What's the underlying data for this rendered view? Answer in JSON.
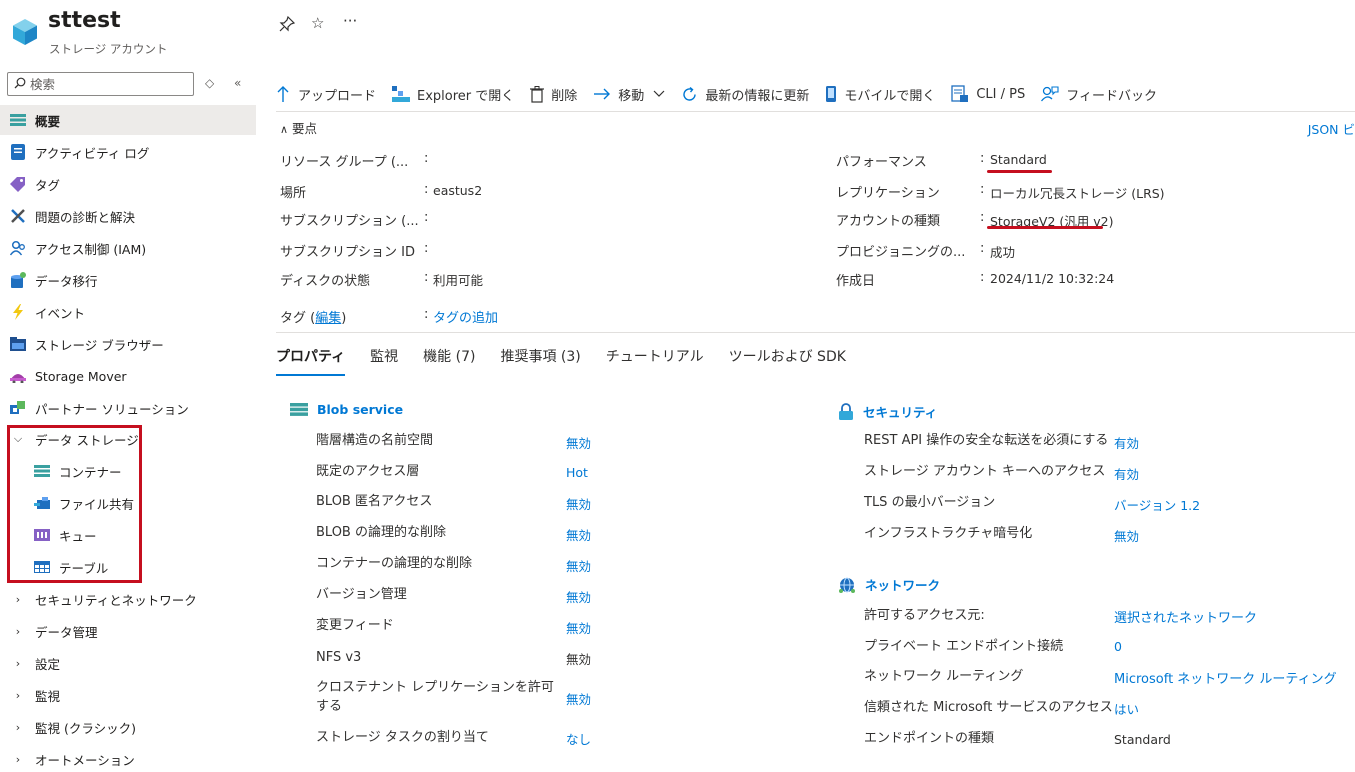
{
  "app": {
    "title": "sttest",
    "subtitle": "ストレージ アカウント"
  },
  "search": {
    "placeholder": "検索"
  },
  "sidebar": {
    "items": [
      {
        "label": "概要",
        "icon": "overview-icon"
      },
      {
        "label": "アクティビティ ログ",
        "icon": "activity-log-icon"
      },
      {
        "label": "タグ",
        "icon": "tag-icon"
      },
      {
        "label": "問題の診断と解決",
        "icon": "wrench-icon"
      },
      {
        "label": "アクセス制御 (IAM)",
        "icon": "iam-icon"
      },
      {
        "label": "データ移行",
        "icon": "data-migration-icon"
      },
      {
        "label": "イベント",
        "icon": "lightning-icon"
      },
      {
        "label": "ストレージ ブラウザー",
        "icon": "storage-browser-icon"
      },
      {
        "label": "Storage Mover",
        "icon": "storage-mover-icon"
      },
      {
        "label": "パートナー ソリューション",
        "icon": "partner-icon"
      }
    ],
    "data_storage": {
      "label": "データ ストレージ",
      "children": [
        "コンテナー",
        "ファイル共有",
        "キュー",
        "テーブル"
      ]
    },
    "groups": [
      "セキュリティとネットワーク",
      "データ管理",
      "設定",
      "監視",
      "監視 (クラシック)",
      "オートメーション"
    ]
  },
  "toolbar": {
    "upload": "アップロード",
    "explorer": "Explorer で開く",
    "delete": "削除",
    "move": "移動",
    "refresh": "最新の情報に更新",
    "mobile": "モバイルで開く",
    "cli": "CLI / PS",
    "feedback": "フィードバック"
  },
  "essentials": {
    "heading": "要点",
    "json_link": "JSON ビ",
    "left": [
      {
        "label": "リソース グループ (...",
        "value": ""
      },
      {
        "label": "場所",
        "value": "eastus2"
      },
      {
        "label": "サブスクリプション (...",
        "value": ""
      },
      {
        "label": "サブスクリプション ID",
        "value": ""
      },
      {
        "label": "ディスクの状態",
        "value": "利用可能"
      }
    ],
    "right": [
      {
        "label": "パフォーマンス",
        "value": "Standard"
      },
      {
        "label": "レプリケーション",
        "value": "ローカル冗長ストレージ (LRS)"
      },
      {
        "label": "アカウントの種類",
        "value": "StorageV2 (汎用 v2)"
      },
      {
        "label": "プロビジョニングの...",
        "value": "成功"
      },
      {
        "label": "作成日",
        "value": "2024/11/2 10:32:24"
      }
    ],
    "tags": {
      "label_prefix": "タグ (",
      "edit_link": "編集",
      "label_suffix": ")",
      "add_link": "タグの追加"
    }
  },
  "tabs": [
    "プロパティ",
    "監視",
    "機能 (7)",
    "推奨事項 (3)",
    "チュートリアル",
    "ツールおよび SDK"
  ],
  "blob": {
    "title": "Blob service",
    "rows": [
      {
        "label": "階層構造の名前空間",
        "value": "無効",
        "link": true
      },
      {
        "label": "既定のアクセス層",
        "value": "Hot",
        "link": true
      },
      {
        "label": "BLOB 匿名アクセス",
        "value": "無効",
        "link": true
      },
      {
        "label": "BLOB の論理的な削除",
        "value": "無効",
        "link": true
      },
      {
        "label": "コンテナーの論理的な削除",
        "value": "無効",
        "link": true
      },
      {
        "label": "バージョン管理",
        "value": "無効",
        "link": true
      },
      {
        "label": "変更フィード",
        "value": "無効",
        "link": true
      },
      {
        "label": "NFS v3",
        "value": "無効",
        "link": false
      },
      {
        "label": "クロステナント レプリケーションを許可する",
        "value": "無効",
        "link": true
      },
      {
        "label": "ストレージ タスクの割り当て",
        "value": "なし",
        "link": true
      }
    ]
  },
  "security": {
    "title": "セキュリティ",
    "rows": [
      {
        "label": "REST API 操作の安全な転送を必須にする",
        "value": "有効",
        "link": true
      },
      {
        "label": "ストレージ アカウント キーへのアクセス",
        "value": "有効",
        "link": true
      },
      {
        "label": "TLS の最小バージョン",
        "value": "バージョン 1.2",
        "link": true
      },
      {
        "label": "インフラストラクチャ暗号化",
        "value": "無効",
        "link": true
      }
    ]
  },
  "network": {
    "title": "ネットワーク",
    "rows": [
      {
        "label": "許可するアクセス元:",
        "value": "選択されたネットワーク",
        "link": true
      },
      {
        "label": "プライベート エンドポイント接続",
        "value": "0",
        "link": true
      },
      {
        "label": "ネットワーク ルーティング",
        "value": "Microsoft ネットワーク ルーティング",
        "link": true
      },
      {
        "label": "信頼された Microsoft サービスのアクセス",
        "value": "はい",
        "link": true
      },
      {
        "label": "エンドポイントの種類",
        "value": "Standard",
        "link": false
      }
    ]
  },
  "colors": {
    "accent": "#0078d4",
    "highlight": "#c50f1f"
  }
}
